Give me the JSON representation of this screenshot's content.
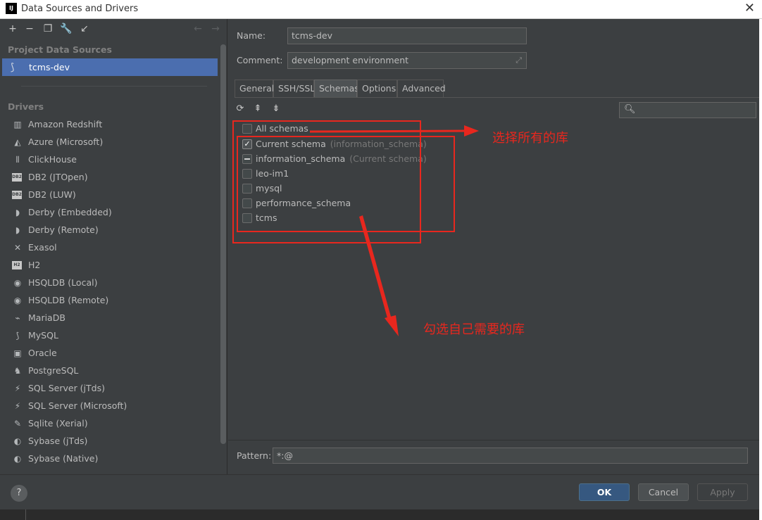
{
  "window": {
    "app_icon": "IJ",
    "title": "Data Sources and Drivers"
  },
  "toolbar": {
    "icons": [
      "add-icon",
      "remove-icon",
      "duplicate-icon",
      "wrench-icon",
      "import-icon",
      "back-arrow-icon",
      "forward-arrow-icon"
    ]
  },
  "sidebar": {
    "project_label": "Project Data Sources",
    "selected_source": "tcms-dev",
    "drivers_label": "Drivers",
    "drivers": [
      "Amazon Redshift",
      "Azure (Microsoft)",
      "ClickHouse",
      "DB2 (JTOpen)",
      "DB2 (LUW)",
      "Derby (Embedded)",
      "Derby (Remote)",
      "Exasol",
      "H2",
      "HSQLDB (Local)",
      "HSQLDB (Remote)",
      "MariaDB",
      "MySQL",
      "Oracle",
      "PostgreSQL",
      "SQL Server (jTds)",
      "SQL Server (Microsoft)",
      "Sqlite (Xerial)",
      "Sybase (jTds)",
      "Sybase (Native)"
    ]
  },
  "form": {
    "name_label": "Name:",
    "name_value": "tcms-dev",
    "comment_label": "Comment:",
    "comment_value": "development environment"
  },
  "tabs": [
    "General",
    "SSH/SSL",
    "Schemas",
    "Options",
    "Advanced"
  ],
  "active_tab": "Schemas",
  "schemas": {
    "all_label": "All schemas",
    "items": [
      {
        "label": "Current schema",
        "hint": "(information_schema)",
        "state": "checked"
      },
      {
        "label": "information_schema",
        "hint": "(Current schema)",
        "state": "partial"
      },
      {
        "label": "leo-im1",
        "hint": "",
        "state": "unchecked"
      },
      {
        "label": "mysql",
        "hint": "",
        "state": "unchecked"
      },
      {
        "label": "performance_schema",
        "hint": "",
        "state": "unchecked"
      },
      {
        "label": "tcms",
        "hint": "",
        "state": "unchecked"
      }
    ]
  },
  "annotations": {
    "select_all": "选择所有的库",
    "select_needed": "勾选自己需要的库",
    "color": "#e8271e"
  },
  "pattern": {
    "label": "Pattern:",
    "value": "*:@"
  },
  "buttons": {
    "help": "?",
    "ok": "OK",
    "cancel": "Cancel",
    "apply": "Apply"
  },
  "colors": {
    "selection": "#4b6eaf",
    "background": "#3c3f41",
    "primary_button": "#365880"
  }
}
